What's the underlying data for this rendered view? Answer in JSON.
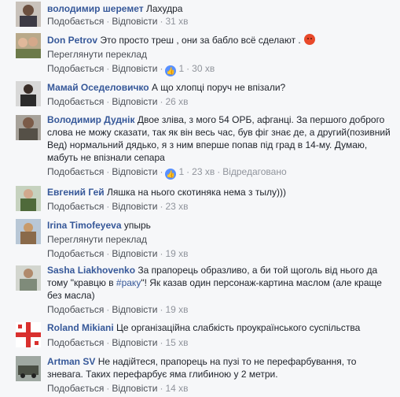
{
  "common": {
    "like": "Подобається",
    "reply": "Відповісти",
    "translate": "Переглянути переклад",
    "sep": "·"
  },
  "comments": [
    {
      "author": "володимир шеремет",
      "text": "Лахудра",
      "time": "31 хв"
    },
    {
      "author": "Don Petrov",
      "text": "Это просто треш , они за бабло всё сделают .",
      "time": "30 хв",
      "likes": "1",
      "emoji": "pouting-face"
    },
    {
      "author": "Мамай Оседеловичко",
      "text": "А що хлопці поруч не впізали?",
      "time": "26 хв"
    },
    {
      "author": "Володимир Дуднік",
      "text": "Двое зліва, з мого 54 ОРБ, афганці. За першого доброго слова не можу сказати, так як він весь час, був фіг знає де, а другий(позивний Вед) нормальний дядько, я з ним вперше попав під град в 14-му. Думаю, мабуть не впізнали сепара",
      "time": "23 хв",
      "likes": "1",
      "edited": "Відредаговано"
    },
    {
      "author": "Евгений Гей",
      "text": "Ляшка на нього скотиняка нема з тылу)))",
      "time": "23 хв"
    },
    {
      "author": "Irina Timofeyeva",
      "text": "упырь",
      "time": "19 хв"
    },
    {
      "author": "Sasha Liakhovenko",
      "text_before": "За прапорець образливо, а би той щоголь від нього да тому \"кравцю в ",
      "hashtag": "#раку",
      "text_after": "\"! Як казав один персонаж-картина маслом (але краще без масла)",
      "time": "19 хв"
    },
    {
      "author": "Roland Mikiani",
      "text": "Це організаційна слабкість проукраїнського суспільства",
      "time": "15 хв"
    },
    {
      "author": "Artman SV",
      "text": "Не надійтеся, прапорець на пузі то не перефарбування, то зневага. Таких перефарбує яма глибиною у 2 метри.",
      "time": "14 хв"
    }
  ]
}
